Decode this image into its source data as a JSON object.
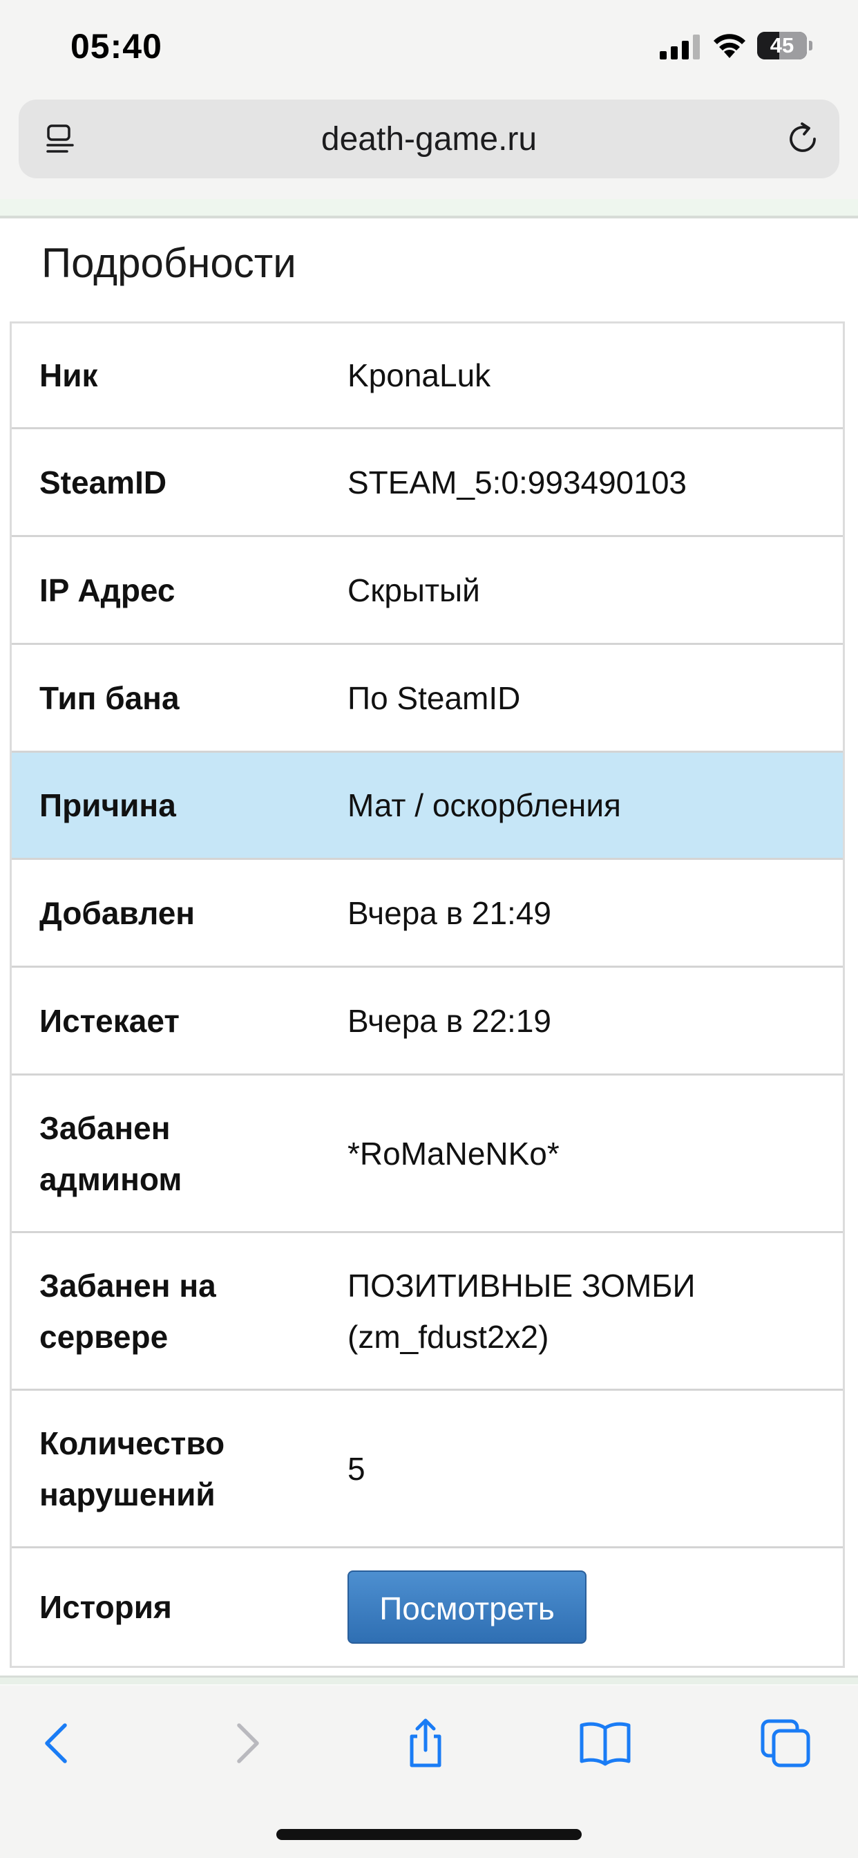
{
  "status_bar": {
    "time": "05:40",
    "battery": "45",
    "battery_level": 0.45
  },
  "browser": {
    "url": "death-game.ru"
  },
  "page": {
    "title": "Подробности",
    "details": [
      {
        "label": "Ник",
        "value": "KponaLuk"
      },
      {
        "label": "SteamID",
        "value": "STEAM_5:0:993490103"
      },
      {
        "label": "IP Адрес",
        "value": "Скрытый"
      },
      {
        "label": "Тип бана",
        "value": "По SteamID"
      },
      {
        "label": "Причина",
        "value": "Мат / оскорбления",
        "highlighted": true
      },
      {
        "label": "Добавлен",
        "value": "Вчера в 21:49"
      },
      {
        "label": "Истекает",
        "value": "Вчера в 22:19"
      },
      {
        "label": "Забанен админом",
        "value": "*RoMaNeNKo*"
      },
      {
        "label": "Забанен на сервере",
        "value": "ПОЗИТИВНЫЕ ЗОМБИ (zm_fdust2x2)"
      },
      {
        "label": "Количество нарушений",
        "value": "5"
      },
      {
        "label": "История",
        "button": "Посмотреть"
      }
    ]
  },
  "toolbar": {
    "icons": [
      "back-icon",
      "forward-icon",
      "share-icon",
      "bookmarks-icon",
      "tabs-icon"
    ],
    "accent": "#1a7cf5",
    "disabled": "#b9b9be"
  },
  "colors": {
    "highlight_row": "#c6e6f7",
    "button": "#3a7cc1"
  }
}
